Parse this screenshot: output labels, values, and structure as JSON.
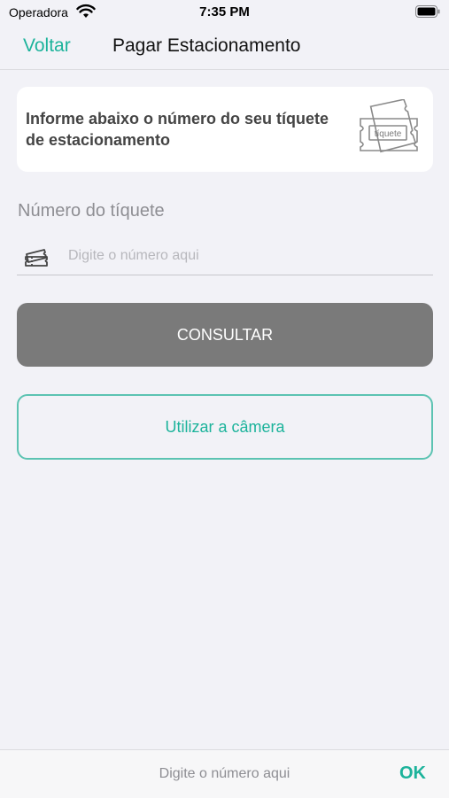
{
  "status_bar": {
    "carrier": "Operadora",
    "time": "7:35 PM"
  },
  "nav": {
    "back_label": "Voltar",
    "title": "Pagar Estacionamento"
  },
  "info_card": {
    "text": "Informe abaixo o número do seu tíquete de estacionamento",
    "illustration_label": "tíquete"
  },
  "ticket_field": {
    "label": "Número do tíquete",
    "placeholder": "Digite o número aqui",
    "value": ""
  },
  "buttons": {
    "consult": "CONSULTAR",
    "camera": "Utilizar a câmera"
  },
  "keyboard_accessory": {
    "placeholder": "Digite o número aqui",
    "ok": "OK"
  },
  "colors": {
    "accent": "#1cb39b",
    "button_gray": "#7a7a7a",
    "background": "#f2f2f7"
  },
  "icons": {
    "wifi": "wifi-icon",
    "battery": "battery-icon",
    "ticket_field": "ticket-icon",
    "card": "ticket-illustration-icon"
  }
}
